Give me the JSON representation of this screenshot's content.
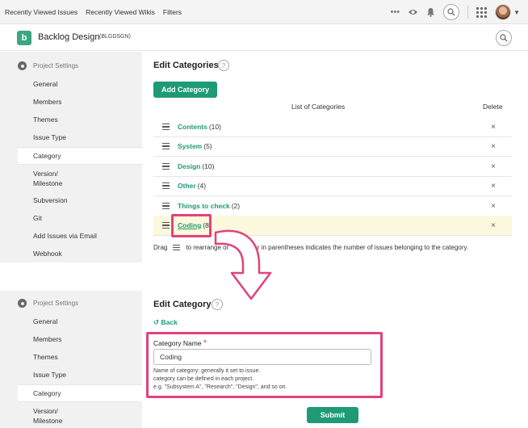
{
  "topbar": {
    "links": [
      "Recently Viewed Issues",
      "Recently Viewed Wikis",
      "Filters"
    ],
    "icons": [
      "more-icon",
      "eye-icon",
      "bell-icon",
      "search-icon",
      "apps-grid-icon",
      "avatar",
      "chevron-down-icon"
    ]
  },
  "project": {
    "logo_letter": "b",
    "name": "Backlog Design",
    "key": "(BLGDSGN)"
  },
  "sidebar": {
    "heading": "Project Settings",
    "items": [
      "General",
      "Members",
      "Themes",
      "Issue Type",
      "Category",
      "Version/\nMilestone",
      "Subversion",
      "Git",
      "Add Issues via Email",
      "Webhook"
    ],
    "items_lower": [
      "General",
      "Members",
      "Themes",
      "Issue Type",
      "Category",
      "Version/\nMilestone"
    ],
    "active": "Category"
  },
  "edit_categories": {
    "title": "Edit Categories",
    "help": "?",
    "add_button": "Add Category",
    "list_header": "List of Categories",
    "delete_header": "Delete",
    "rows": [
      {
        "name": "Contents",
        "count": "(10)"
      },
      {
        "name": "System",
        "count": "(5)"
      },
      {
        "name": "Design",
        "count": "(10)"
      },
      {
        "name": "Other",
        "count": "(4)"
      },
      {
        "name": "Things to check",
        "count": "(2)"
      },
      {
        "name": "Coding",
        "count": "(8)"
      }
    ],
    "delete_glyph": "×",
    "note_before": "Drag",
    "note_after": "to rearrange or",
    "note_tail": "mber in parentheses indicates the number of issues belonging to the category."
  },
  "edit_category": {
    "title": "Edit Category",
    "help": "?",
    "back": "Back",
    "back_glyph": "↺",
    "field_label": "Category Name",
    "required_mark": "*",
    "field_value": "Coding",
    "help_lines": [
      "Name of category: generally it set to issue.",
      "category can be defined in each project.",
      "e.g. \"Subsystem A\", \"Research\", \"Design\", and so on."
    ],
    "submit": "Submit"
  },
  "colors": {
    "accent": "#1e9a74",
    "highlight": "#e0437c",
    "row_highlight": "#fcf8dd"
  }
}
